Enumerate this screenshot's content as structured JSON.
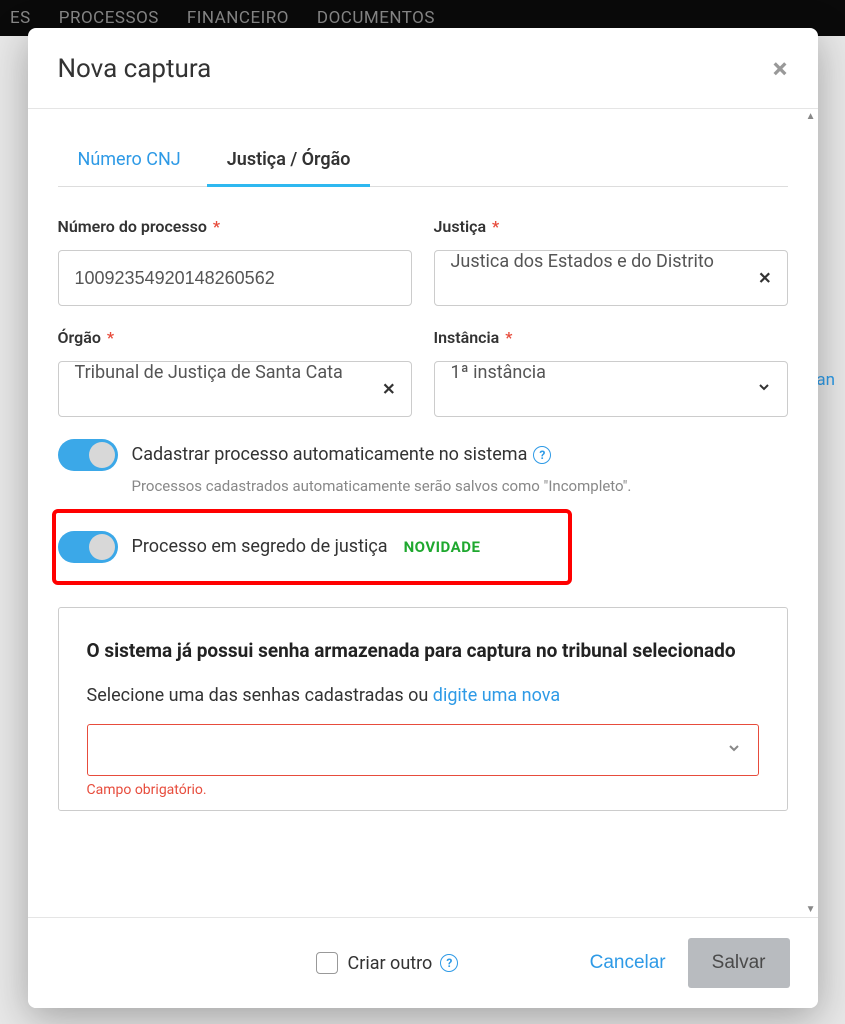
{
  "topbar": {
    "items": [
      "ES",
      "PROCESSOS",
      "FINANCEIRO",
      "DOCUMENTOS"
    ]
  },
  "bg": {
    "link_fragment": "n an"
  },
  "modal": {
    "title": "Nova captura",
    "tabs": {
      "cnj": "Número CNJ",
      "justica": "Justiça / Órgão"
    },
    "fields": {
      "numero_label": "Número do processo",
      "numero_value": "10092354920148260562",
      "justica_label": "Justiça",
      "justica_value": "Justica dos Estados e do Distrito",
      "orgao_label": "Órgão",
      "orgao_value": "Tribunal de Justiça de Santa Cata",
      "instancia_label": "Instância",
      "instancia_value": "1ª instância"
    },
    "toggles": {
      "auto_label": "Cadastrar processo automaticamente no sistema",
      "auto_hint": "Processos cadastrados automaticamente serão salvos como \"Incompleto\".",
      "segredo_label": "Processo em segredo de justiça",
      "novidade": "NOVIDADE"
    },
    "panel": {
      "title": "O sistema já possui senha armazenada para captura no tribunal selecionado",
      "text_prefix": "Selecione uma das senhas cadastradas ou ",
      "text_link": "digite uma nova",
      "error": "Campo obrigatório."
    },
    "footer": {
      "criar_outro": "Criar outro",
      "cancelar": "Cancelar",
      "salvar": "Salvar"
    }
  }
}
